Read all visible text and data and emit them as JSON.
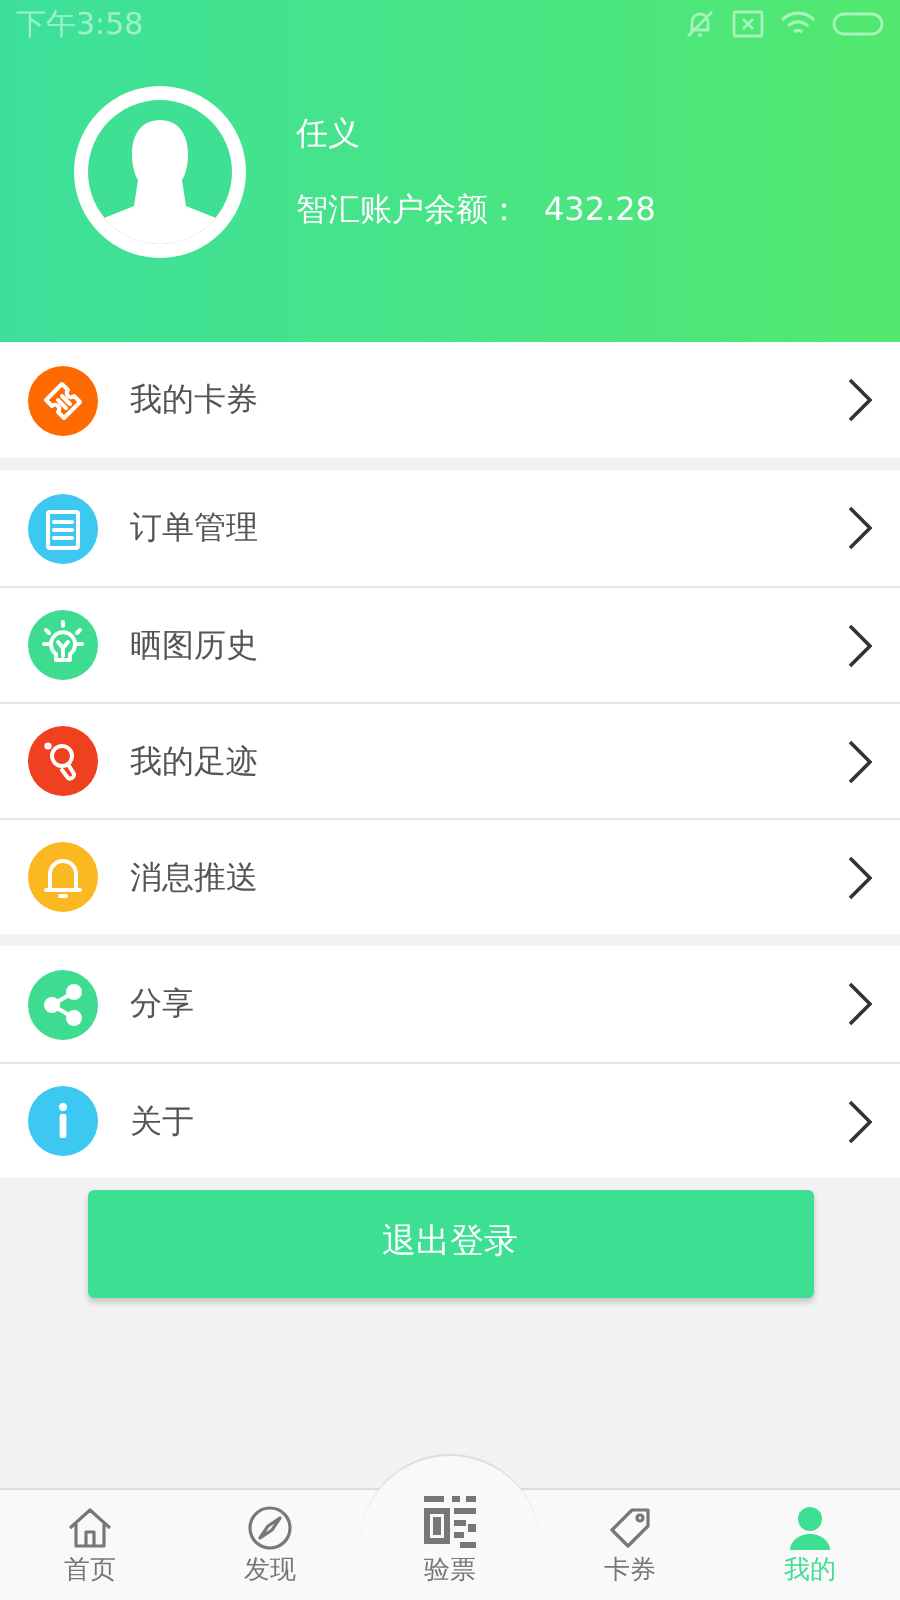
{
  "status_bar": {
    "time": "下午3:58"
  },
  "profile": {
    "name": "任义",
    "balance_label": "智汇账户余额：",
    "balance": "432.28"
  },
  "menu_groups": [
    [
      {
        "kind": "ticket",
        "label": "我的卡券",
        "color": "#ff6a00"
      }
    ],
    [
      {
        "kind": "clipboard",
        "label": "订单管理",
        "color": "#3cc8f0"
      },
      {
        "kind": "bulb",
        "label": "晒图历史",
        "color": "#3ddc91"
      },
      {
        "kind": "footprint",
        "label": "我的足迹",
        "color": "#ef4020"
      },
      {
        "kind": "bell",
        "label": "消息推送",
        "color": "#fbb820"
      }
    ],
    [
      {
        "kind": "share",
        "label": "分享",
        "color": "#3ddc91"
      },
      {
        "kind": "info",
        "label": "关于",
        "color": "#3cc8f0"
      }
    ]
  ],
  "logout_button": "退出登录",
  "tabs": [
    {
      "kind": "home",
      "label": "首页",
      "selected": false
    },
    {
      "kind": "compass",
      "label": "发现",
      "selected": false
    },
    {
      "kind": "scan",
      "label": "验票",
      "selected": false
    },
    {
      "kind": "tag",
      "label": "卡券",
      "selected": false
    },
    {
      "kind": "user",
      "label": "我的",
      "selected": true
    }
  ]
}
